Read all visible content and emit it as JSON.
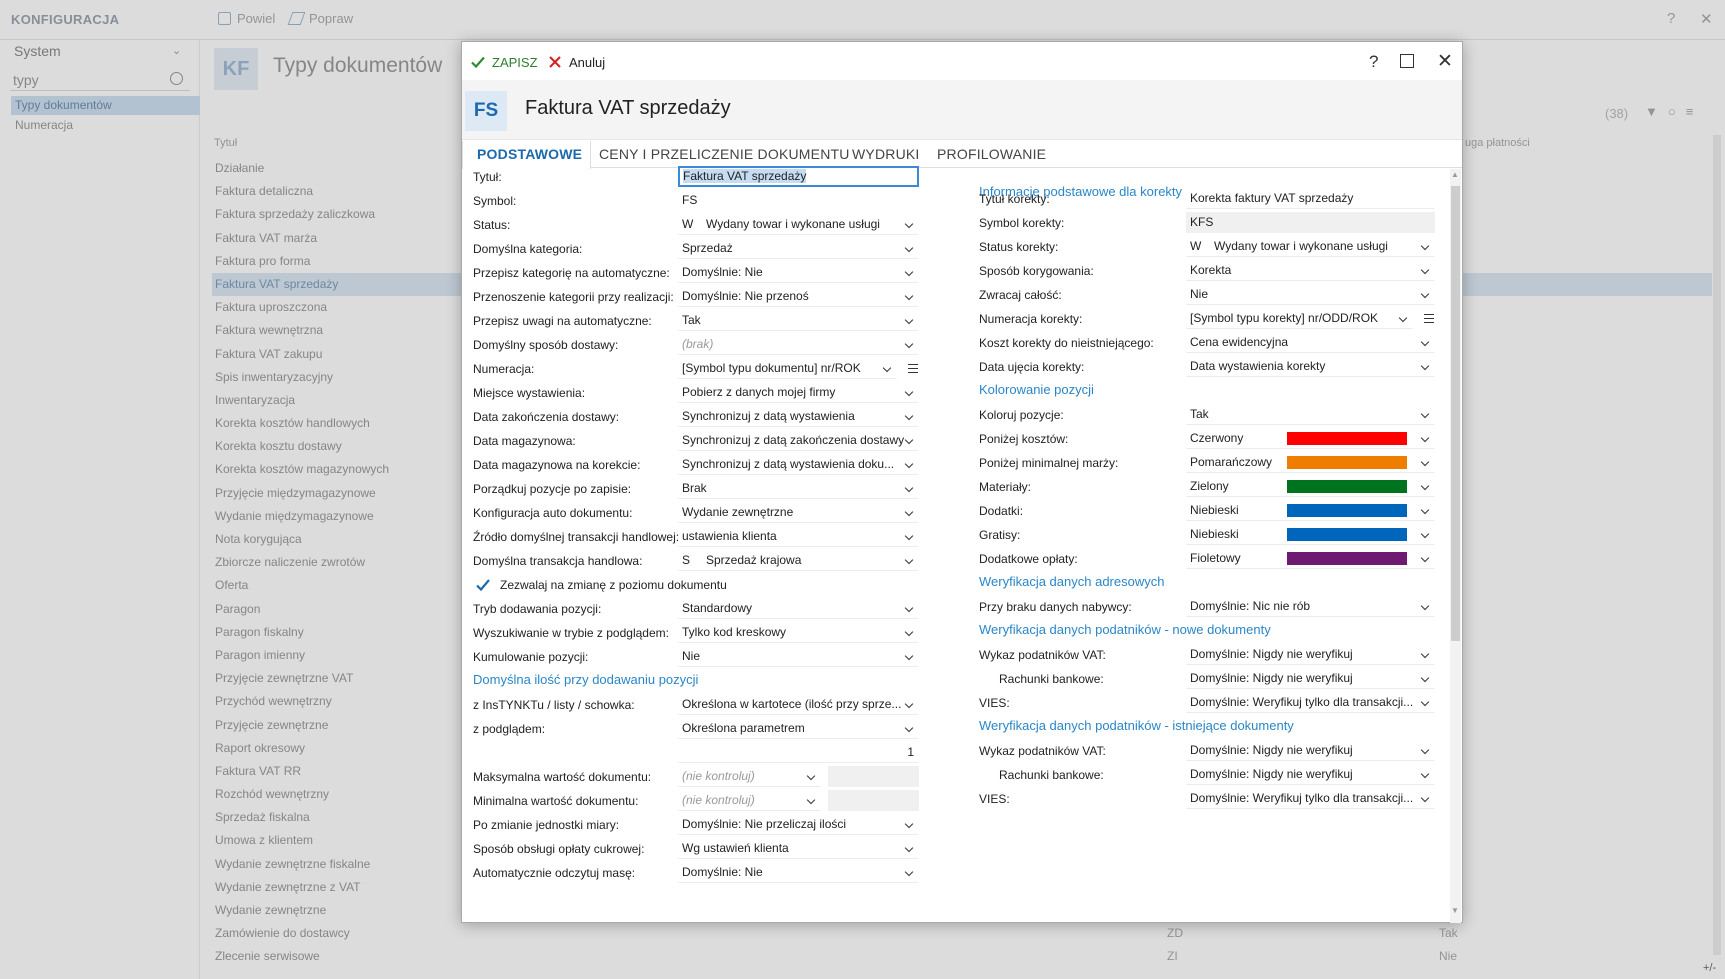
{
  "bg": {
    "app_title": "KONFIGURACJA",
    "toolbar": {
      "duplicate": "Powiel",
      "edit": "Popraw"
    },
    "help": "?",
    "system": "System",
    "search_value": "typy",
    "nav": [
      "Typy dokumentów",
      "Numeracja"
    ],
    "badge": "KF",
    "page_title": "Typy dokumentów",
    "count": "(38)",
    "col_title": "Tytuł",
    "col_payment": "uga płatności",
    "rows": [
      {
        "t": "Działanie",
        "c2": "",
        "c3": ""
      },
      {
        "t": "Faktura detaliczna",
        "c2": "",
        "c3": ""
      },
      {
        "t": "Faktura sprzedaży zaliczkowa",
        "c2": "",
        "c3": ""
      },
      {
        "t": "Faktura VAT marża",
        "c2": "",
        "c3": ""
      },
      {
        "t": "Faktura pro forma",
        "c2": "",
        "c3": ""
      },
      {
        "t": "Faktura VAT sprzedaży",
        "c2": "",
        "c3": ""
      },
      {
        "t": "Faktura uproszczona",
        "c2": "",
        "c3": ""
      },
      {
        "t": "Faktura wewnętrzna",
        "c2": "",
        "c3": ""
      },
      {
        "t": "Faktura VAT zakupu",
        "c2": "",
        "c3": ""
      },
      {
        "t": "Spis inwentaryzacyjny",
        "c2": "",
        "c3": ""
      },
      {
        "t": "Inwentaryzacja",
        "c2": "",
        "c3": ""
      },
      {
        "t": "Korekta kosztów handlowych",
        "c2": "",
        "c3": ""
      },
      {
        "t": "Korekta kosztu dostawy",
        "c2": "",
        "c3": ""
      },
      {
        "t": "Korekta kosztów magazynowych",
        "c2": "",
        "c3": ""
      },
      {
        "t": "Przyjęcie międzymagazynowe",
        "c2": "",
        "c3": ""
      },
      {
        "t": "Wydanie międzymagazynowe",
        "c2": "",
        "c3": ""
      },
      {
        "t": "Nota korygująca",
        "c2": "",
        "c3": ""
      },
      {
        "t": "Zbiorcze naliczenie zwrotów",
        "c2": "",
        "c3": ""
      },
      {
        "t": "Oferta",
        "c2": "",
        "c3": ""
      },
      {
        "t": "Paragon",
        "c2": "",
        "c3": ""
      },
      {
        "t": "Paragon fiskalny",
        "c2": "",
        "c3": ""
      },
      {
        "t": "Paragon imienny",
        "c2": "",
        "c3": ""
      },
      {
        "t": "Przyjęcie zewnętrzne VAT",
        "c2": "",
        "c3": ""
      },
      {
        "t": "Przychód wewnętrzny",
        "c2": "",
        "c3": ""
      },
      {
        "t": "Przyjęcie zewnętrzne",
        "c2": "",
        "c3": ""
      },
      {
        "t": "Raport okresowy",
        "c2": "",
        "c3": ""
      },
      {
        "t": "Faktura VAT RR",
        "c2": "",
        "c3": ""
      },
      {
        "t": "Rozchód wewnętrzny",
        "c2": "",
        "c3": ""
      },
      {
        "t": "Sprzedaż fiskalna",
        "c2": "",
        "c3": ""
      },
      {
        "t": "Umowa z klientem",
        "c2": "",
        "c3": ""
      },
      {
        "t": "Wydanie zewnętrzne fiskalne",
        "c2": "",
        "c3": ""
      },
      {
        "t": "Wydanie zewnętrzne z VAT",
        "c2": "",
        "c3": ""
      },
      {
        "t": "Wydanie zewnętrzne",
        "c2": "",
        "c3": ""
      },
      {
        "t": "Zamówienie do dostawcy",
        "c2": "ZD",
        "c3": "Tak"
      },
      {
        "t": "Zlecenie serwisowe",
        "c2": "ZI",
        "c3": "Nie"
      }
    ],
    "plusminus": "+/-"
  },
  "dialog": {
    "save": "ZAPISZ",
    "cancel": "Anuluj",
    "help": "?",
    "badge": "FS",
    "title": "Faktura VAT sprzedaży",
    "tabs": [
      "PODSTAWOWE",
      "CENY I PRZELICZENIE DOKUMENTU",
      "WYDRUKI",
      "PROFILOWANIE"
    ],
    "left": [
      {
        "label": "Tytuł:",
        "value": "Faktura VAT sprzedaży",
        "kind": "focus"
      },
      {
        "label": "Symbol:",
        "value": "FS",
        "kind": "plain"
      },
      {
        "label": "Status:",
        "code": "W",
        "value": "Wydany towar i wykonane usługi",
        "kind": "sel"
      },
      {
        "label": "Domyślna kategoria:",
        "value": "Sprzedaż",
        "kind": "sel"
      },
      {
        "label": "Przepisz kategorię na automatyczne:",
        "value": "Domyślnie: Nie",
        "kind": "sel"
      },
      {
        "label": "Przenoszenie kategorii przy realizacji:",
        "value": "Domyślnie: Nie przenoś",
        "kind": "sel"
      },
      {
        "label": "Przepisz uwagi na automatyczne:",
        "value": "Tak",
        "kind": "sel"
      },
      {
        "label": "Domyślny sposób dostawy:",
        "value": "(brak)",
        "kind": "sel-ph"
      },
      {
        "label": "Numeracja:",
        "value": "[Symbol typu dokumentu] nr/ROK",
        "kind": "sel-ham"
      },
      {
        "label": "Miejsce wystawienia:",
        "value": "Pobierz z danych mojej firmy",
        "kind": "sel"
      },
      {
        "label": "Data zakończenia dostawy:",
        "value": "Synchronizuj z datą wystawienia",
        "kind": "sel"
      },
      {
        "label": "Data magazynowa:",
        "value": "Synchronizuj z datą zakończenia dostawy",
        "kind": "sel"
      },
      {
        "label": "Data magazynowa na korekcie:",
        "value": "Synchronizuj z datą wystawienia doku...",
        "kind": "sel"
      },
      {
        "label": "Porządkuj pozycje po zapisie:",
        "value": "Brak",
        "kind": "sel"
      },
      {
        "label": "Konfiguracja auto dokumentu:",
        "value": "Wydanie zewnętrzne",
        "kind": "sel"
      },
      {
        "label": "Źródło domyślnej transakcji handlowej:",
        "value": "ustawienia klienta",
        "kind": "sel"
      },
      {
        "label": "Domyślna transakcja handlowa:",
        "code": "S",
        "value": "Sprzedaż krajowa",
        "kind": "sel"
      }
    ],
    "checkbox_label": "Zezwalaj na zmianę z poziomu dokumentu",
    "left2": [
      {
        "label": "Tryb dodawania pozycji:",
        "value": "Standardowy",
        "kind": "sel"
      },
      {
        "label": "Wyszukiwanie w trybie z podglądem:",
        "value": "Tylko kod kreskowy",
        "kind": "sel"
      },
      {
        "label": "Kumulowanie pozycji:",
        "value": "Nie",
        "kind": "sel"
      }
    ],
    "section_qty": "Domyślna ilość przy dodawaniu pozycji",
    "qty": [
      {
        "label": "z InsTYNKTu / listy / schowka:",
        "value": "Określona w kartotece (ilość przy sprze...",
        "kind": "sel"
      },
      {
        "label": "z podglądem:",
        "value": "Określona parametrem",
        "kind": "sel"
      }
    ],
    "qty_value": "1",
    "max_label": "Maksymalna wartość dokumentu:",
    "max_value": "(nie kontroluj)",
    "min_label": "Minimalna wartość dokumentu:",
    "min_value": "(nie kontroluj)",
    "left3": [
      {
        "label": "Po zmianie jednostki miary:",
        "value": "Domyślnie: Nie przeliczaj ilości",
        "kind": "sel"
      },
      {
        "label": "Sposób obsługi opłaty cukrowej:",
        "value": "Wg ustawień klienta",
        "kind": "sel"
      },
      {
        "label": "Automatycznie odczytuj masę:",
        "value": "Domyślnie: Nie",
        "kind": "sel"
      }
    ],
    "sec_korekta": "Informacje podstawowe dla korekty",
    "korekta": [
      {
        "label": "Tytuł korekty:",
        "value": "Korekta faktury VAT sprzedaży",
        "kind": "txt"
      },
      {
        "label": "Symbol korekty:",
        "value": "KFS",
        "kind": "grey"
      },
      {
        "label": "Status korekty:",
        "code": "W",
        "value": "Wydany towar i wykonane usługi",
        "kind": "sel"
      },
      {
        "label": "Sposób korygowania:",
        "value": "Korekta",
        "kind": "sel"
      },
      {
        "label": "Zwracaj całość:",
        "value": "Nie",
        "kind": "sel"
      },
      {
        "label": "Numeracja korekty:",
        "value": "[Symbol typu korekty] nr/ODD/ROK",
        "kind": "sel-ham"
      },
      {
        "label": "Koszt korekty do nieistniejącego:",
        "value": "Cena ewidencyjna",
        "kind": "sel"
      },
      {
        "label": "Data ujęcia korekty:",
        "value": "Data wystawienia korekty",
        "kind": "sel"
      }
    ],
    "sec_color": "Kolorowanie pozycji",
    "color_first": {
      "label": "Koloruj pozycje:",
      "value": "Tak"
    },
    "colors": [
      {
        "label": "Poniżej kosztów:",
        "value": "Czerwony",
        "hex": "#ff0000"
      },
      {
        "label": "Poniżej minimalnej marży:",
        "value": "Pomarańczowy",
        "hex": "#ef7d00"
      },
      {
        "label": "Materiały:",
        "value": "Zielony",
        "hex": "#00731f"
      },
      {
        "label": "Dodatki:",
        "value": "Niebieski",
        "hex": "#0066bb"
      },
      {
        "label": "Gratisy:",
        "value": "Niebieski",
        "hex": "#0066bb"
      },
      {
        "label": "Dodatkowe opłaty:",
        "value": "Fioletowy",
        "hex": "#6e1a73"
      }
    ],
    "sec_addr": "Weryfikacja danych adresowych",
    "addr": {
      "label": "Przy braku danych nabywcy:",
      "value": "Domyślnie: Nic nie rób"
    },
    "sec_new": "Weryfikacja danych podatników - nowe dokumenty",
    "new_docs": [
      {
        "label": "Wykaz podatników VAT:",
        "value": "Domyślnie: Nigdy nie weryfikuj",
        "indent": false
      },
      {
        "label": "Rachunki bankowe:",
        "value": "Domyślnie: Nigdy nie weryfikuj",
        "indent": true
      },
      {
        "label": "VIES:",
        "value": "Domyślnie: Weryfikuj tylko dla transakcji...",
        "indent": false
      }
    ],
    "sec_exist": "Weryfikacja danych podatników - istniejące dokumenty",
    "exist_docs": [
      {
        "label": "Wykaz podatników VAT:",
        "value": "Domyślnie: Nigdy nie weryfikuj",
        "indent": false
      },
      {
        "label": "Rachunki bankowe:",
        "value": "Domyślnie: Nigdy nie weryfikuj",
        "indent": true
      },
      {
        "label": "VIES:",
        "value": "Domyślnie: Weryfikuj tylko dla transakcji...",
        "indent": false
      }
    ],
    "colors_accent": {
      "primary": "#1c6aad",
      "section": "#2a86c8",
      "save_icon": "#2e8b2e",
      "cancel_icon": "#d32020"
    }
  }
}
